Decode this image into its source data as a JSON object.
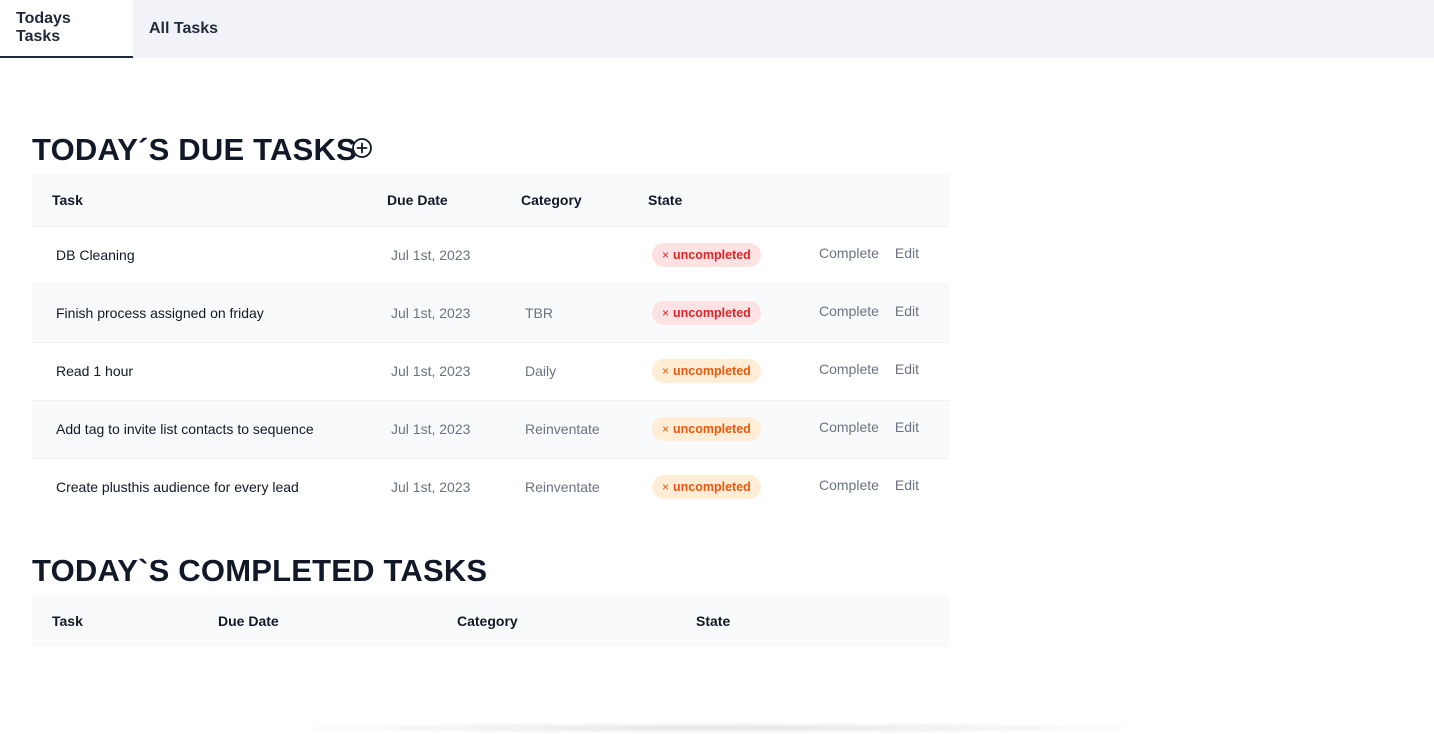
{
  "tabs": [
    {
      "label": "Todays Tasks",
      "active": true
    },
    {
      "label": "All Tasks",
      "active": false
    }
  ],
  "due_section": {
    "title": "TODAY´S DUE TASKS",
    "add_icon": "plus-circle-icon",
    "columns": [
      "Task",
      "Due Date",
      "Category",
      "State"
    ],
    "rows": [
      {
        "task": "DB Cleaning",
        "due_date": "Jul 1st, 2023",
        "category": "",
        "state": "uncompleted",
        "state_color": "#dc2626",
        "complete": "Complete",
        "edit": "Edit"
      },
      {
        "task": "Finish process assigned on friday",
        "due_date": "Jul 1st, 2023",
        "category": "TBR",
        "state": "uncompleted",
        "state_color": "#dc2626",
        "complete": "Complete",
        "edit": "Edit"
      },
      {
        "task": "Read 1 hour",
        "due_date": "Jul 1st, 2023",
        "category": "Daily",
        "state": "uncompleted",
        "state_color": "#ea580c",
        "complete": "Complete",
        "edit": "Edit"
      },
      {
        "task": "Add tag to invite list contacts to sequence",
        "due_date": "Jul 1st, 2023",
        "category": "Reinventate",
        "state": "uncompleted",
        "state_color": "#ea580c",
        "complete": "Complete",
        "edit": "Edit"
      },
      {
        "task": "Create plusthis audience for every lead",
        "due_date": "Jul 1st, 2023",
        "category": "Reinventate",
        "state": "uncompleted",
        "state_color": "#ea580c",
        "complete": "Complete",
        "edit": "Edit"
      }
    ]
  },
  "completed_section": {
    "title": "TODAY`S COMPLETED TASKS",
    "columns": [
      "Task",
      "Due Date",
      "Category",
      "State"
    ]
  },
  "badge_close_glyph": "×"
}
